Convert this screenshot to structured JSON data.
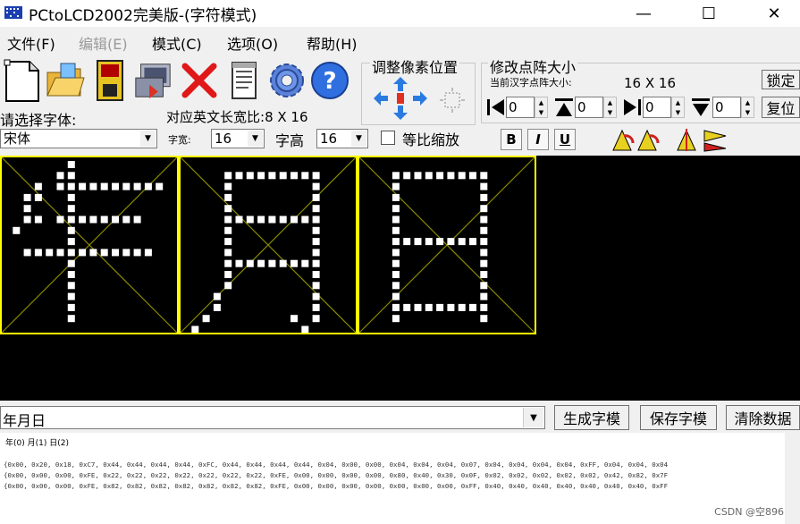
{
  "window": {
    "title": "PCtoLCD2002完美版-(字符模式)",
    "minimize_glyph": "—",
    "maximize_glyph": "☐",
    "close_glyph": "✕"
  },
  "menu": [
    {
      "label": "文件(F)",
      "enabled": true
    },
    {
      "label": "编辑(E)",
      "enabled": false
    },
    {
      "label": "模式(C)",
      "enabled": true
    },
    {
      "label": "选项(O)",
      "enabled": true
    },
    {
      "label": "帮助(H)",
      "enabled": true
    }
  ],
  "toolbar": {
    "icons": [
      "new-file-icon",
      "open-folder-icon",
      "save-floppy-icon",
      "import-image-icon",
      "delete-x-icon",
      "notepad-icon",
      "settings-gear-icon",
      "help-question-icon"
    ],
    "adjust_group_title": "调整像素位置",
    "dot_matrix_group_title": "修改点阵大小",
    "current_size_label": "当前汉字点阵大小:",
    "current_size_value": "16 X 16",
    "lock_button": "锁定",
    "reset_button": "复位",
    "spin_values": [
      "0",
      "0",
      "0",
      "0"
    ]
  },
  "font_panel": {
    "choose_font_label": "请选择字体:",
    "english_width_label": "对应英文长宽比:",
    "english_width_value": "8 X 16",
    "font_value": "宋体",
    "width_label": "字宽:",
    "width_value": "16",
    "height_label": "字高",
    "height_value": "16",
    "proportional_label": "等比缩放",
    "proportional_checked": false,
    "bold_label": "B",
    "italic_label": "I",
    "underline_label": "U"
  },
  "colors": {
    "canvas_bg": "#000000",
    "grid_border": "#ffff00",
    "guide_line": "#8a8a00",
    "pixel_on": "#ffffff"
  },
  "glyphs": [
    {
      "char": "年",
      "rows": [
        "0000001000000000",
        "0000011000000000",
        "0001011111111110",
        "0011001000000000",
        "0010001000000000",
        "0011011111111000",
        "0100001000000000",
        "0000001000000000",
        "0011111111111100",
        "0000001000000000",
        "0000001000000000",
        "0000001000000000",
        "0000001000000000",
        "0000001000000000",
        "0000001000000000",
        "0000000000000000"
      ]
    },
    {
      "char": "月",
      "rows": [
        "0000000000000000",
        "0000111111111000",
        "0000100000001000",
        "0000100000001000",
        "0000100000001000",
        "0000111111111000",
        "0000100000001000",
        "0000100000001000",
        "0000100000001000",
        "0000111111111000",
        "0000100000001000",
        "0000100000001000",
        "0001000000001000",
        "0001000000001000",
        "0010000000101000",
        "0100000000010000"
      ]
    },
    {
      "char": "日",
      "rows": [
        "0000000000000000",
        "0001111111110000",
        "0001000000010000",
        "0001000000010000",
        "0001000000010000",
        "0001000000010000",
        "0001000000010000",
        "0001111111110000",
        "0001000000010000",
        "0001000000010000",
        "0001000000010000",
        "0001000000010000",
        "0001000000010000",
        "0001111111110000",
        "0001000000010000",
        "0000000000000000"
      ]
    }
  ],
  "bottom": {
    "input_text": "年月日",
    "generate_button": "生成字模",
    "save_button": "保存字模",
    "clear_button": "清除数据",
    "index_line": "年(0)  月(1)  日(2)",
    "output_lines": [
      "{0x00, 0x20, 0x18, 0xC7, 0x44, 0x44, 0x44, 0x44, 0xFC, 0x44, 0x44, 0x44, 0x44, 0x04, 0x00, 0x00, 0x04, 0x04, 0x04, 0x07, 0x04, 0x04, 0x04, 0x04, 0xFF, 0x04, 0x04, 0x04",
      "{0x00, 0x00, 0x00, 0xFE, 0x22, 0x22, 0x22, 0x22, 0x22, 0x22, 0x22, 0xFE, 0x00, 0x00, 0x00, 0x00, 0x80, 0x40, 0x30, 0x0F, 0x02, 0x02, 0x02, 0x02, 0x02, 0x42, 0x82, 0x7F",
      "{0x00, 0x00, 0x00, 0xFE, 0x82, 0x82, 0x82, 0x82, 0x82, 0x82, 0x82, 0xFE, 0x00, 0x00, 0x00, 0x00, 0x00, 0x00, 0x00, 0xFF, 0x40, 0x40, 0x40, 0x40, 0x40, 0x40, 0x40, 0xFF"
    ]
  },
  "watermark": "CSDN @空896"
}
